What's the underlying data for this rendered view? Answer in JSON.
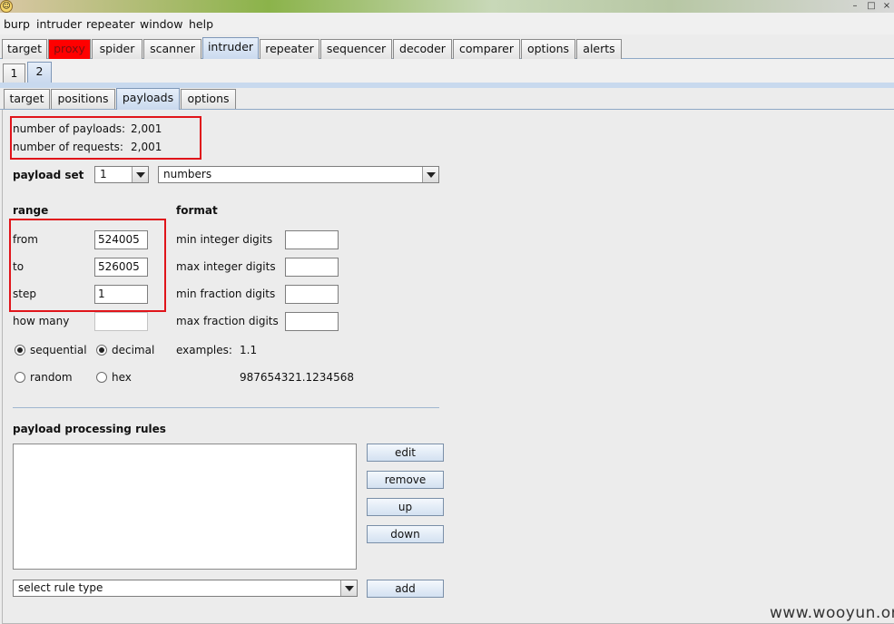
{
  "menu": [
    "burp",
    "intruder",
    "repeater",
    "window",
    "help"
  ],
  "main_tabs": [
    "target",
    "proxy",
    "spider",
    "scanner",
    "intruder",
    "repeater",
    "sequencer",
    "decoder",
    "comparer",
    "options",
    "alerts"
  ],
  "attack_tabs": [
    "1",
    "2"
  ],
  "inner_tabs": [
    "target",
    "positions",
    "payloads",
    "options"
  ],
  "counts": {
    "payloads_label": "number of payloads:",
    "payloads_value": "2,001",
    "requests_label": "number of requests:",
    "requests_value": "2,001"
  },
  "payload_set": {
    "label": "payload set",
    "set_value": "1",
    "type_value": "numbers"
  },
  "range": {
    "heading": "range",
    "from_label": "from",
    "from_value": "524005",
    "to_label": "to",
    "to_value": "526005",
    "step_label": "step",
    "step_value": "1",
    "how_many_label": "how many",
    "how_many_value": "",
    "sequential_label": "sequential",
    "random_label": "random"
  },
  "format": {
    "heading": "format",
    "min_int_label": "min integer digits",
    "max_int_label": "max integer digits",
    "min_frac_label": "min fraction digits",
    "max_frac_label": "max fraction digits",
    "decimal_label": "decimal",
    "hex_label": "hex",
    "examples_label": "examples:",
    "example_1": "1.1",
    "example_2": "987654321.1234568"
  },
  "rules": {
    "heading": "payload processing rules",
    "edit": "edit",
    "remove": "remove",
    "up": "up",
    "down": "down",
    "select_value": "select rule type",
    "add": "add"
  },
  "watermark": "www.wooyun.org",
  "colors": {
    "proxy_tab": "#ff0000",
    "highlight_box": "#e0141a",
    "selected_tab": "#c9d9ee"
  }
}
